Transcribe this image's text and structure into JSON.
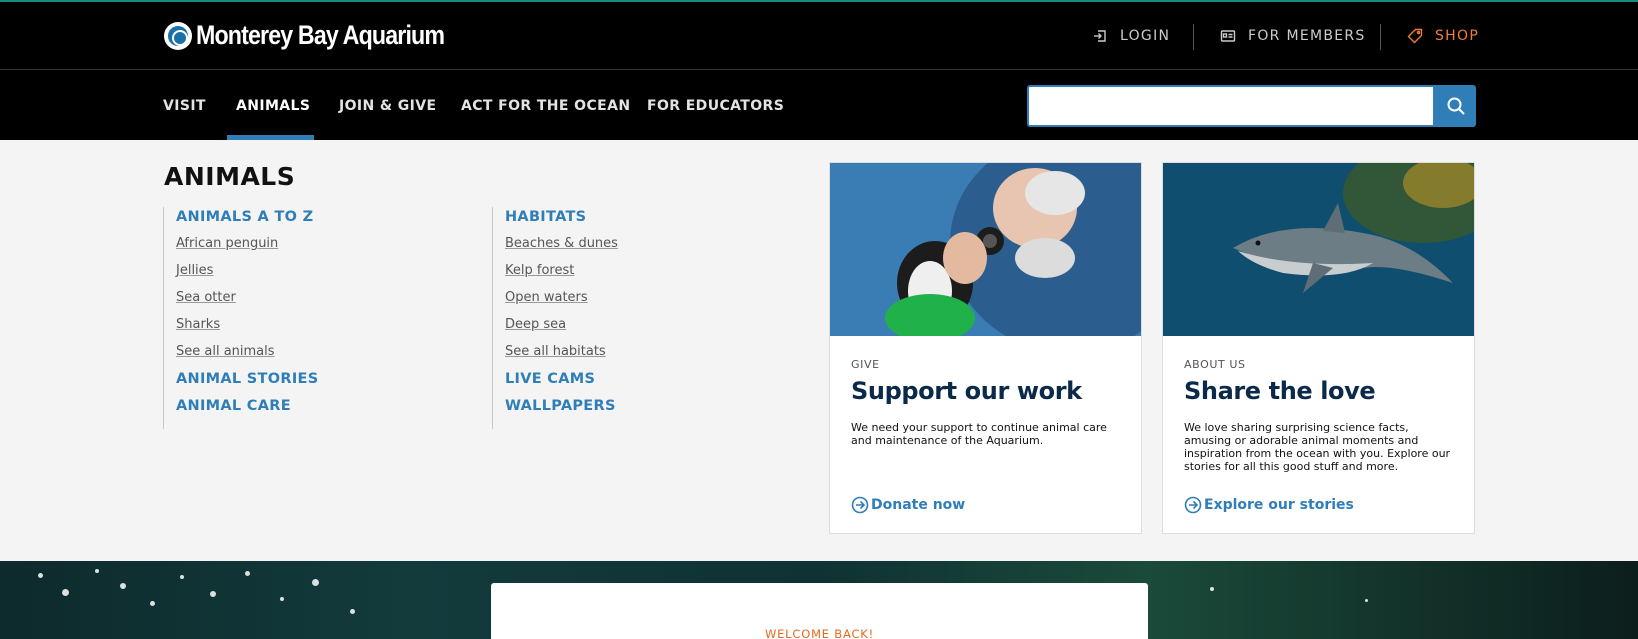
{
  "header": {
    "logo_text": "Monterey Bay Aquarium",
    "utility": {
      "login": "LOGIN",
      "members": "FOR MEMBERS",
      "shop": "SHOP"
    }
  },
  "nav": {
    "items": [
      {
        "label": "VISIT"
      },
      {
        "label": "ANIMALS",
        "active": true
      },
      {
        "label": "JOIN & GIVE"
      },
      {
        "label": "ACT FOR THE OCEAN"
      },
      {
        "label": "FOR EDUCATORS"
      }
    ],
    "search": {
      "value": "",
      "placeholder": ""
    }
  },
  "menu": {
    "title": "ANIMALS",
    "col1": {
      "heading": "ANIMALS A TO Z",
      "links": [
        "African penguin",
        "Jellies",
        "Sea otter",
        "Sharks",
        "See all animals"
      ],
      "extra": [
        "ANIMAL STORIES",
        "ANIMAL CARE"
      ]
    },
    "col2": {
      "heading": "HABITATS",
      "links": [
        "Beaches & dunes",
        "Kelp forest",
        "Open waters",
        "Deep sea",
        "See all habitats"
      ],
      "extra": [
        "LIVE CAMS",
        "WALLPAPERS"
      ]
    }
  },
  "cards": [
    {
      "tag": "GIVE",
      "title": "Support our work",
      "description": "We need your support to continue animal care and maintenance of the Aquarium.",
      "link": "Donate now"
    },
    {
      "tag": "ABOUT US",
      "title": "Share the love",
      "description": "We love sharing surprising science facts, amusing or adorable animal moments and inspiration from the ocean with you. Explore our stories for all this good stuff and more.",
      "link": "Explore our stories"
    }
  ],
  "hero": {
    "welcome": "WELCOME BACK!"
  },
  "colors": {
    "accent": "#2f7eb8",
    "shop": "#f07d3a",
    "welcome": "#e56a1e",
    "card_title": "#0b2a4a"
  }
}
